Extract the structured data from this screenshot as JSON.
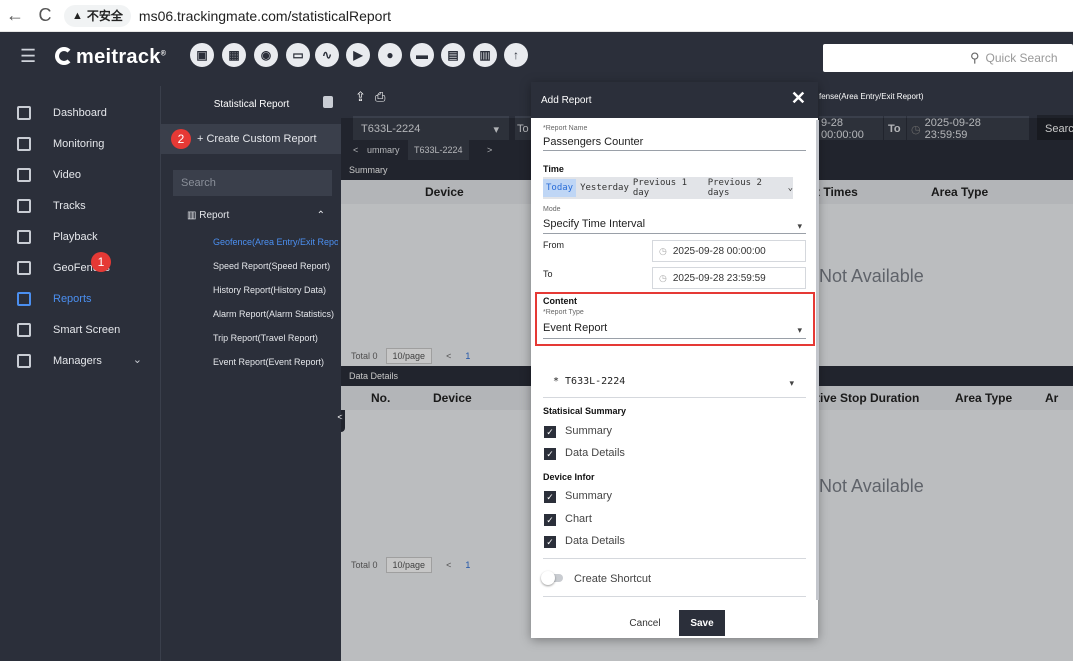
{
  "browser": {
    "back_icon": "←",
    "reload_icon": "C",
    "security_label": "不安全",
    "url": "ms06.trackingmate.com/statisticalReport"
  },
  "topbar": {
    "logo_text": "meitrack",
    "logo_mark": "®",
    "quick_search_placeholder": "Quick Search",
    "icons": [
      "monitor-icon",
      "dashboard-icon",
      "monitoring-icon",
      "video-icon",
      "tracks-icon",
      "playback-icon",
      "user-icon",
      "car-icon",
      "card-icon",
      "calendar-icon",
      "upload-icon"
    ]
  },
  "sidebar": {
    "items": [
      {
        "label": "Dashboard",
        "icon": "dashboard-icon"
      },
      {
        "label": "Monitoring",
        "icon": "location-icon"
      },
      {
        "label": "Video",
        "icon": "video-icon"
      },
      {
        "label": "Tracks",
        "icon": "tracks-icon"
      },
      {
        "label": "Playback",
        "icon": "playback-icon"
      },
      {
        "label": "GeoFences",
        "icon": "geofence-icon"
      },
      {
        "label": "Reports",
        "icon": "reports-icon"
      },
      {
        "label": "Smart Screen",
        "icon": "screen-icon"
      },
      {
        "label": "Managers",
        "icon": "managers-icon"
      }
    ],
    "badge_1": "1"
  },
  "panel": {
    "title": "Statistical Report",
    "badge_2": "2",
    "create_label": "+ Create Custom Report",
    "search_placeholder": "Search",
    "group_label": "Report",
    "links": [
      "Geofence(Area Entry/Exit Report)",
      "Speed Report(Speed Report)",
      "History Report(History Data)",
      "Alarm Report(Alarm Statistics)",
      "Trip Report(Travel Report)",
      "Event Report(Event Report)"
    ]
  },
  "main": {
    "device_select": "T633L-2224",
    "to_label_short": "To",
    "report_title_fragment": "fense(Area Entry/Exit Report)",
    "from_value_fragment": "9-28 00:00:00",
    "to_label": "To",
    "to_value": "2025-09-28 23:59:59",
    "search_btn": "Searc",
    "tab_prev": "<",
    "tab_summary": "ummary",
    "tab_device": "T633L-2224",
    "tab_next": ">",
    "summary_header": "Summary",
    "summary_cols": [
      "Device",
      "t Times",
      "Area Type"
    ],
    "not_available": "Not Available",
    "total_label": "Total 0",
    "page_size": "10/page",
    "page_prev": "<",
    "page_num": "1",
    "details_header": "Data Details",
    "details_cols": [
      "No.",
      "Device",
      "tive Stop Duration",
      "Area Type",
      "Ar"
    ],
    "collapse_icon": "<"
  },
  "modal": {
    "title": "Add Report",
    "report_name_label": "*Report Name",
    "report_name_value": "Passengers Counter",
    "time_label": "Time",
    "quick_today": "Today",
    "quick_options": [
      "Yesterday",
      "Previous 1 day",
      "Previous 2 days"
    ],
    "mode_label": "Mode",
    "mode_value": "Specify Time Interval",
    "from_label": "From",
    "from_value": "2025-09-28 00:00:00",
    "to_label": "To",
    "to_value": "2025-09-28 23:59:59",
    "content_label": "Content",
    "report_type_label": "*Report Type",
    "report_type_value": "Event Report",
    "device_value": "* T633L-2224",
    "stat_summary_label": "Statisical Summary",
    "stat_items": [
      "Summary",
      "Data Details"
    ],
    "device_infor_label": "Device Infor",
    "device_items": [
      "Summary",
      "Chart",
      "Data Details"
    ],
    "shortcut_label": "Create Shortcut",
    "cancel_label": "Cancel",
    "save_label": "Save"
  },
  "colors": {
    "dark": "#2b2f3a",
    "accent": "#4b8ff0",
    "highlight_red": "#e53935"
  }
}
